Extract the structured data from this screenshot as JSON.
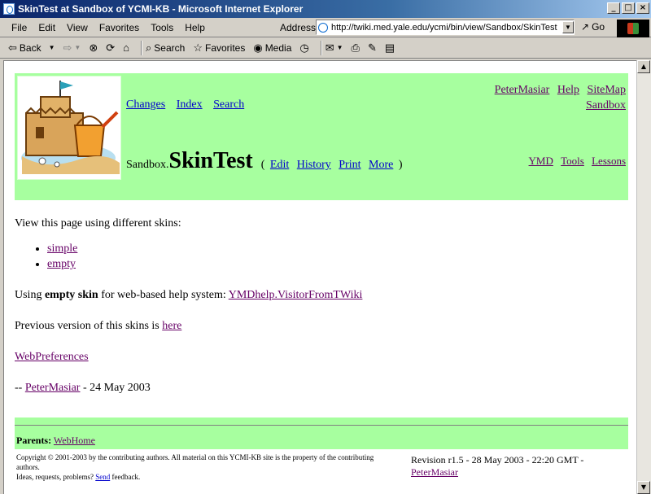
{
  "window": {
    "title": "SkinTest at Sandbox of YCMI-KB - Microsoft Internet Explorer",
    "buttons": [
      "_",
      "□",
      "×"
    ]
  },
  "menu": {
    "items": [
      "File",
      "Edit",
      "View",
      "Favorites",
      "Tools",
      "Help"
    ],
    "address_label": "Address",
    "url": "http://twiki.med.yale.edu/ycmi/bin/view/Sandbox/SkinTest",
    "go_label": "Go"
  },
  "toolbar": {
    "back": "Back",
    "search": "Search",
    "favorites": "Favorites",
    "media": "Media"
  },
  "header": {
    "top_links": [
      "Changes",
      "Index",
      "Search"
    ],
    "right_links_row1": [
      "PeterMasiar",
      "Help",
      "SiteMap"
    ],
    "right_links_row2": "Sandbox",
    "web_name": "Sandbox.",
    "topic_name": "SkinTest",
    "actions_open": "(",
    "actions": [
      "Edit",
      "History",
      "Print",
      "More"
    ],
    "actions_close": ")",
    "sub_links": [
      "YMD",
      "Tools",
      "Lessons"
    ]
  },
  "content": {
    "intro": "View this page using different skins:",
    "skins": [
      "simple",
      "empty"
    ],
    "help_prefix": "Using",
    "help_bold": "empty skin",
    "help_middle": "for web-based help system:",
    "help_link": "YMDhelp.VisitorFromTWiki",
    "prev_text": "Previous version of this skins is",
    "prev_link": "here",
    "webprefs_link": "WebPreferences",
    "sig_dash": "--",
    "sig_author": "PeterMasiar",
    "sig_date": "- 24 May 2003"
  },
  "footer": {
    "parents_label": "Parents:",
    "parents_link": "WebHome",
    "copyright_line1": "Copyright © 2001-2003 by the contributing authors. All material on this YCMI-KB site is the property of the contributing authors.",
    "copyright_line2_prefix": "Ideas, requests, problems?",
    "copyright_send": "Send",
    "copyright_line2_suffix": "feedback.",
    "revision": "Revision r1.5 - 28 May 2003 - 22:20 GMT -",
    "revision_author": "PeterMasiar"
  },
  "colors": {
    "header_bg": "#a7ff9f",
    "link": "#0000cc",
    "visited_link": "#660066"
  }
}
